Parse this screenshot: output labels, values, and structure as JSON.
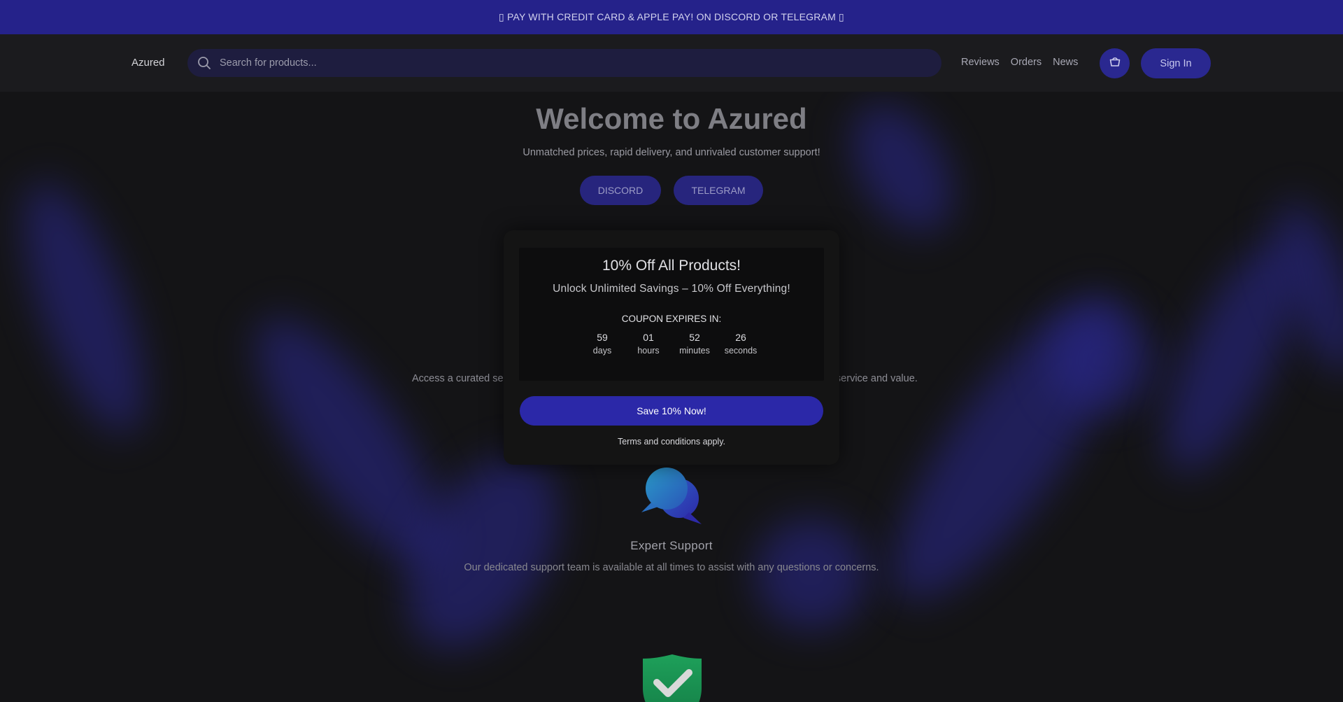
{
  "banner": {
    "text": "▯ PAY WITH CREDIT CARD & APPLE PAY! ON DISCORD OR TELEGRAM ▯"
  },
  "header": {
    "logo": "Azured",
    "search": {
      "placeholder": "Search for products..."
    },
    "nav": [
      "Reviews",
      "Orders",
      "News"
    ],
    "cart_icon": "basket-icon",
    "signin_label": "Sign In"
  },
  "hero": {
    "title": "Welcome to Azured",
    "subtitle": "Unmatched prices, rapid delivery, and unrivaled customer support!",
    "buttons": [
      "DISCORD",
      "TELEGRAM"
    ]
  },
  "features": {
    "intro_left": "Access a curated se",
    "intro_right": "er service and value.",
    "support": {
      "icon": "chat-bubbles-icon",
      "title": "Expert Support",
      "description": "Our dedicated support team is available at all times to assist with any questions or concerns."
    },
    "next_icon": "shield-check-icon"
  },
  "modal": {
    "title": "10% Off All Products!",
    "subtitle": "Unlock Unlimited Savings – 10% Off Everything!",
    "expires_label": "COUPON EXPIRES IN:",
    "countdown": [
      {
        "value": "59",
        "unit": "days"
      },
      {
        "value": "01",
        "unit": "hours"
      },
      {
        "value": "52",
        "unit": "minutes"
      },
      {
        "value": "26",
        "unit": "seconds"
      }
    ],
    "cta": "Save 10% Now!",
    "terms": "Terms and conditions apply."
  },
  "colors": {
    "accent": "#2b28a8",
    "banner": "#25228a",
    "background": "#141416"
  }
}
